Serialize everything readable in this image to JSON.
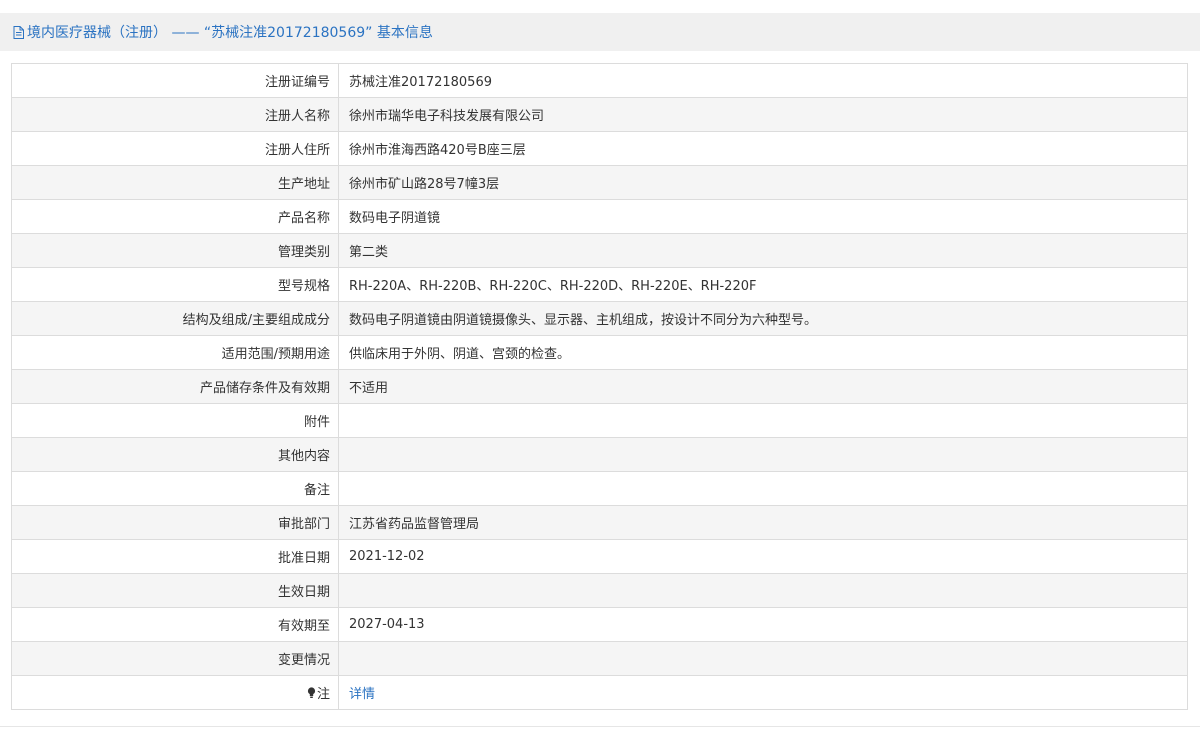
{
  "header": {
    "icon": "document-icon",
    "title": "境内医疗器械（注册） —— “苏械注准20172180569” 基本信息"
  },
  "rows": [
    {
      "label": "注册证编号",
      "value": "苏械注准20172180569"
    },
    {
      "label": "注册人名称",
      "value": "徐州市瑞华电子科技发展有限公司"
    },
    {
      "label": "注册人住所",
      "value": "徐州市淮海西路420号B座三层"
    },
    {
      "label": "生产地址",
      "value": "徐州市矿山路28号7幢3层"
    },
    {
      "label": "产品名称",
      "value": "数码电子阴道镜"
    },
    {
      "label": "管理类别",
      "value": "第二类"
    },
    {
      "label": "型号规格",
      "value": "RH-220A、RH-220B、RH-220C、RH-220D、RH-220E、RH-220F"
    },
    {
      "label": "结构及组成/主要组成成分",
      "value": "数码电子阴道镜由阴道镜摄像头、显示器、主机组成，按设计不同分为六种型号。"
    },
    {
      "label": "适用范围/预期用途",
      "value": "供临床用于外阴、阴道、宫颈的检查。"
    },
    {
      "label": "产品储存条件及有效期",
      "value": "不适用"
    },
    {
      "label": "附件",
      "value": ""
    },
    {
      "label": "其他内容",
      "value": ""
    },
    {
      "label": "备注",
      "value": ""
    },
    {
      "label": "审批部门",
      "value": "江苏省药品监督管理局"
    },
    {
      "label": "批准日期",
      "value": "2021-12-02"
    },
    {
      "label": "生效日期",
      "value": ""
    },
    {
      "label": "有效期至",
      "value": "2027-04-13"
    },
    {
      "label": "变更情况",
      "value": ""
    }
  ],
  "note_row": {
    "icon": "lightbulb-icon",
    "label": "注",
    "link_text": "详情"
  },
  "colors": {
    "accent": "#2b73c2",
    "header_bg": "#f0f0f0",
    "row_alt_bg": "#f5f5f5",
    "border": "#dcdcdc"
  }
}
